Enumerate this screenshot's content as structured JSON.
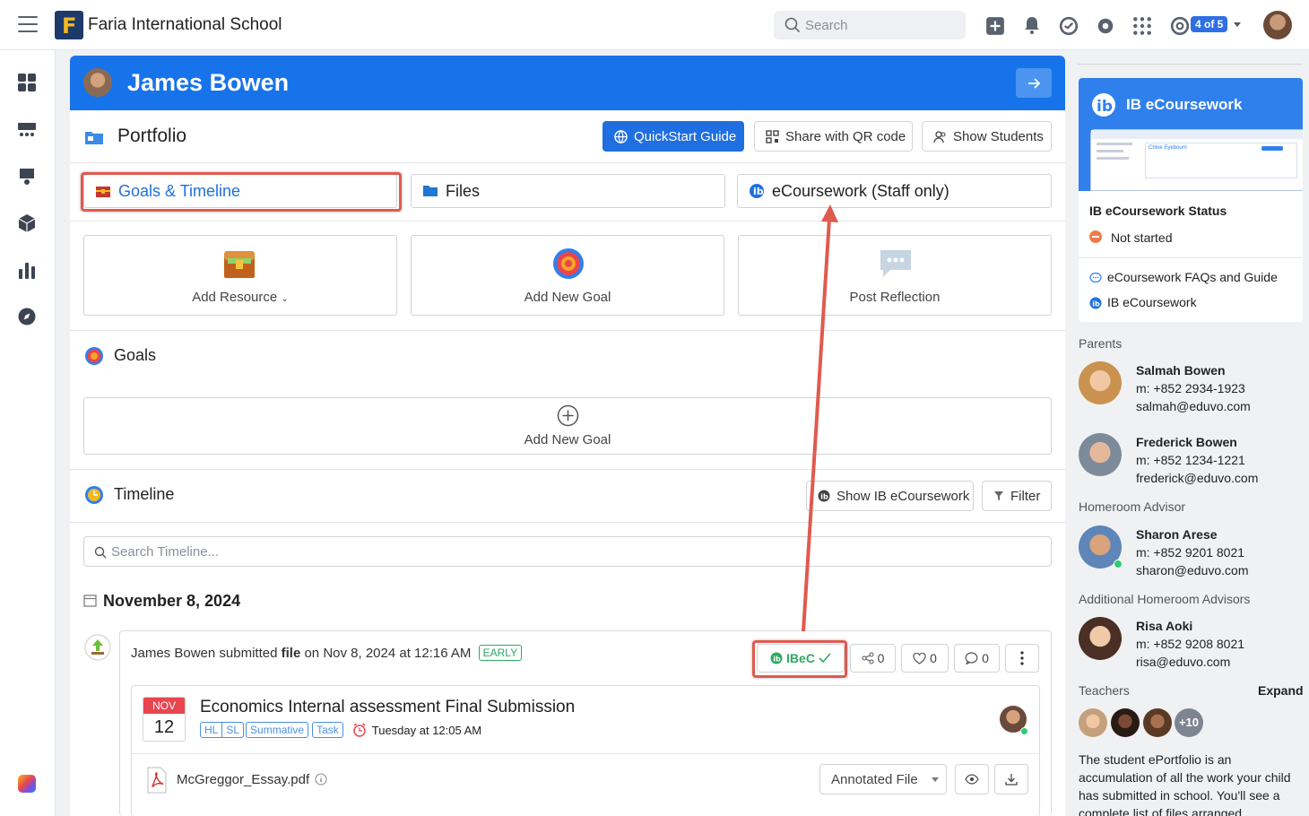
{
  "app": {
    "school_name": "Faria International School",
    "search_placeholder": "Search",
    "switcher_badge": "4 of 5"
  },
  "student": {
    "name": "James Bowen"
  },
  "portfolio": {
    "title": "Portfolio",
    "buttons": {
      "quickstart": "QuickStart Guide",
      "share_qr": "Share with QR code",
      "show_students": "Show Students"
    },
    "tabs": [
      {
        "label": "Goals & Timeline",
        "active": true
      },
      {
        "label": "Files",
        "active": false
      },
      {
        "label": "eCoursework (Staff only)",
        "active": false
      }
    ],
    "actions": [
      {
        "label": "Add Resource"
      },
      {
        "label": "Add New Goal"
      },
      {
        "label": "Post Reflection"
      }
    ]
  },
  "goals": {
    "title": "Goals",
    "add_label": "Add New Goal"
  },
  "timeline": {
    "title": "Timeline",
    "show_ib_label": "Show IB eCoursework",
    "filter_label": "Filter",
    "search_placeholder": "Search Timeline...",
    "date_heading": "November 8, 2024",
    "entry": {
      "actor": "James Bowen",
      "verb": "submitted",
      "object": "file",
      "when": "on Nov 8, 2024 at 12:16 AM",
      "badge": "EARLY",
      "ibec_label": "IBeC",
      "shares": "0",
      "likes": "0",
      "comments": "0",
      "assignment": {
        "month": "NOV",
        "day": "12",
        "title": "Economics Internal assessment Final Submission",
        "tags": [
          "HL",
          "SL",
          "Summative",
          "Task"
        ],
        "due": "Tuesday at 12:05 AM"
      },
      "file": {
        "name": "McGreggor_Essay.pdf",
        "annotated_label": "Annotated File"
      }
    }
  },
  "sidebar": {
    "ib_card_title": "IB eCoursework",
    "mini_shot_name": "Chloe Eyeboum",
    "status_heading": "IB eCoursework Status",
    "status_value": "Not started",
    "links": [
      "eCoursework FAQs and Guide",
      "IB eCoursework"
    ],
    "parents_label": "Parents",
    "parents": [
      {
        "name": "Salmah Bowen",
        "phone": "m: +852 2934-1923",
        "email": "salmah@eduvo.com"
      },
      {
        "name": "Frederick Bowen",
        "phone": "m: +852 1234-1221",
        "email": "frederick@eduvo.com"
      }
    ],
    "homeroom_label": "Homeroom Advisor",
    "homeroom": {
      "name": "Sharon Arese",
      "phone": "m: +852 9201 8021",
      "email": "sharon@eduvo.com"
    },
    "additional_label": "Additional Homeroom Advisors",
    "additional": {
      "name": "Risa Aoki",
      "phone": "m: +852 9208 8021",
      "email": "risa@eduvo.com"
    },
    "teachers_label": "Teachers",
    "expand_label": "Expand",
    "teachers_more": "+10",
    "description": "The student ePortfolio is an accumulation of all the work your child has submitted in school. You'll see a complete list of files arranged"
  },
  "colors": {
    "brand_blue": "#1773ea",
    "highlight_red": "#e05a4f",
    "success_green": "#2ea862"
  }
}
